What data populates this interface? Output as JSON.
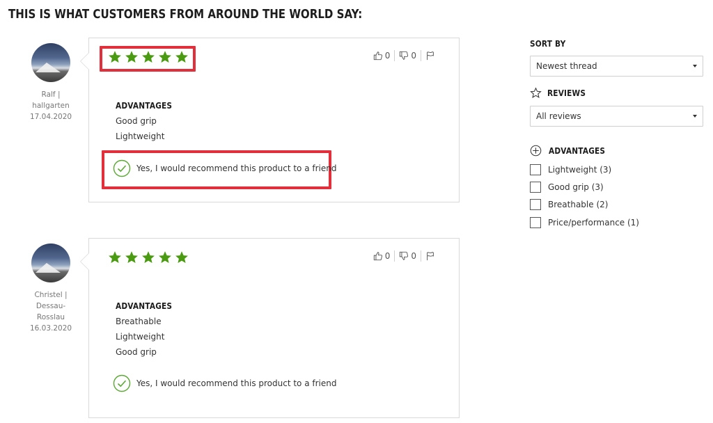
{
  "page": {
    "title": "THIS IS WHAT CUSTOMERS FROM AROUND THE WORLD SAY:"
  },
  "colors": {
    "star_green": "#4a9a12",
    "check_green": "#5aa832",
    "highlight_red": "#e1303c"
  },
  "reviews": [
    {
      "author_line1": "Ralf |",
      "author_line2": "hallgarten",
      "author_line3": "",
      "date": "17.04.2020",
      "rating": 5,
      "rating_max": 5,
      "likes": "0",
      "dislikes": "0",
      "advantages_heading": "ADVANTAGES",
      "advantages": [
        "Good grip",
        "Lightweight"
      ],
      "recommend_text": "Yes, I would recommend this product to a friend"
    },
    {
      "author_line1": "Christel |",
      "author_line2": "Dessau-",
      "author_line3": "Rosslau",
      "date": "16.03.2020",
      "rating": 5,
      "rating_max": 5,
      "likes": "0",
      "dislikes": "0",
      "advantages_heading": "ADVANTAGES",
      "advantages": [
        "Breathable",
        "Lightweight",
        "Good grip"
      ],
      "recommend_text": "Yes, I would recommend this product to a friend"
    }
  ],
  "sidebar": {
    "sort_label": "SORT BY",
    "sort_value": "Newest thread",
    "reviews_label": "REVIEWS",
    "reviews_value": "All reviews",
    "advantages_label": "ADVANTAGES",
    "filters": [
      {
        "label": "Lightweight (3)",
        "checked": false
      },
      {
        "label": "Good grip (3)",
        "checked": false
      },
      {
        "label": "Breathable (2)",
        "checked": false
      },
      {
        "label": "Price/performance (1)",
        "checked": false
      }
    ]
  },
  "icons": {
    "star": "star-icon",
    "like": "thumbs-up-icon",
    "dislike": "thumbs-down-icon",
    "report": "flag-icon",
    "recommend": "check-circle-icon",
    "reviews": "star-outline-icon",
    "advantages": "plus-circle-icon"
  }
}
